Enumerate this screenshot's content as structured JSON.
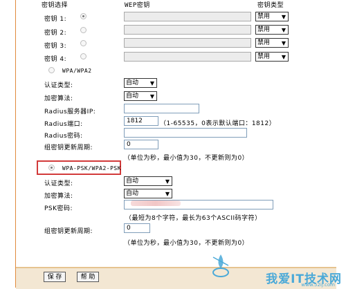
{
  "header": {
    "key_select": "密钥选择",
    "wep_key": "WEP密钥",
    "key_type": "密钥类型"
  },
  "wep_keys": [
    {
      "label": "密钥 1:",
      "type": "禁用",
      "selected": true
    },
    {
      "label": "密钥 2:",
      "type": "禁用",
      "selected": false
    },
    {
      "label": "密钥 3:",
      "type": "禁用",
      "selected": false
    },
    {
      "label": "密钥 4:",
      "type": "禁用",
      "selected": false
    }
  ],
  "wpa": {
    "mode_label": "WPA/WPA2",
    "auth_label": "认证类型:",
    "auth_value": "自动",
    "algo_label": "加密算法:",
    "algo_value": "自动",
    "radius_ip_label": "Radius服务器IP:",
    "radius_ip_value": "",
    "radius_port_label": "Radius端口:",
    "radius_port_value": "1812",
    "radius_port_hint": "（1-65535，0表示默认端口：1812）",
    "radius_pwd_label": "Radius密码:",
    "radius_pwd_value": "",
    "group_label": "组密钥更新周期:",
    "group_value": "0",
    "group_hint": "（单位为秒，最小值为30，不更新则为0）"
  },
  "psk": {
    "mode_label": "WPA-PSK/WPA2-PSK",
    "auth_label": "认证类型:",
    "auth_value": "自动",
    "algo_label": "加密算法:",
    "algo_value": "自动",
    "psk_label": "PSK密码:",
    "psk_value": "",
    "psk_hint": "（最短为8个字符，最长为63个ASCII码字符）",
    "group_label": "组密钥更新周期:",
    "group_value": "0",
    "group_hint": "（单位为秒，最小值为30，不更新则为0）"
  },
  "footer": {
    "save_label": "保 存",
    "help_label": "帮 助"
  },
  "watermark": {
    "text": "我爱IT技术网",
    "url": "www.52ij.com"
  },
  "colors": {
    "highlight_border": "#d23a3a",
    "footer_bar": "#f3e7d3",
    "watermark": "#4aa9d8"
  }
}
